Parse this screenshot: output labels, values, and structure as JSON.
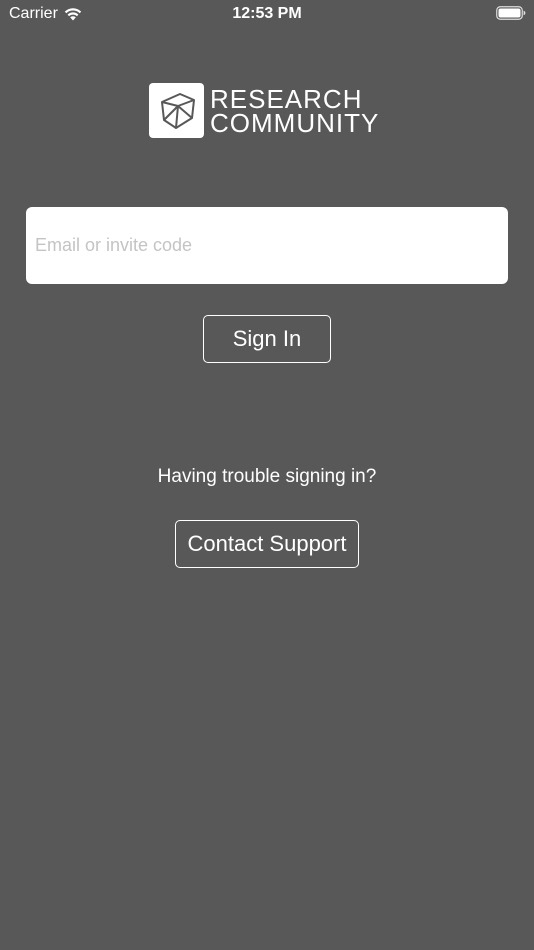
{
  "status_bar": {
    "carrier": "Carrier",
    "time": "12:53 PM",
    "wifi_icon": "wifi-icon",
    "battery_icon": "battery-icon"
  },
  "logo": {
    "line1": "RESEARCH",
    "line2": "COMMUNITY",
    "icon": "polyhedron-logo-icon"
  },
  "login": {
    "email_placeholder": "Email or invite code",
    "email_value": "",
    "sign_in_label": "Sign In"
  },
  "support": {
    "prompt": "Having trouble signing in?",
    "contact_label": "Contact Support"
  },
  "colors": {
    "background": "#585858",
    "foreground": "#ffffff",
    "input_background": "#ffffff",
    "placeholder": "#c4c4c6"
  }
}
